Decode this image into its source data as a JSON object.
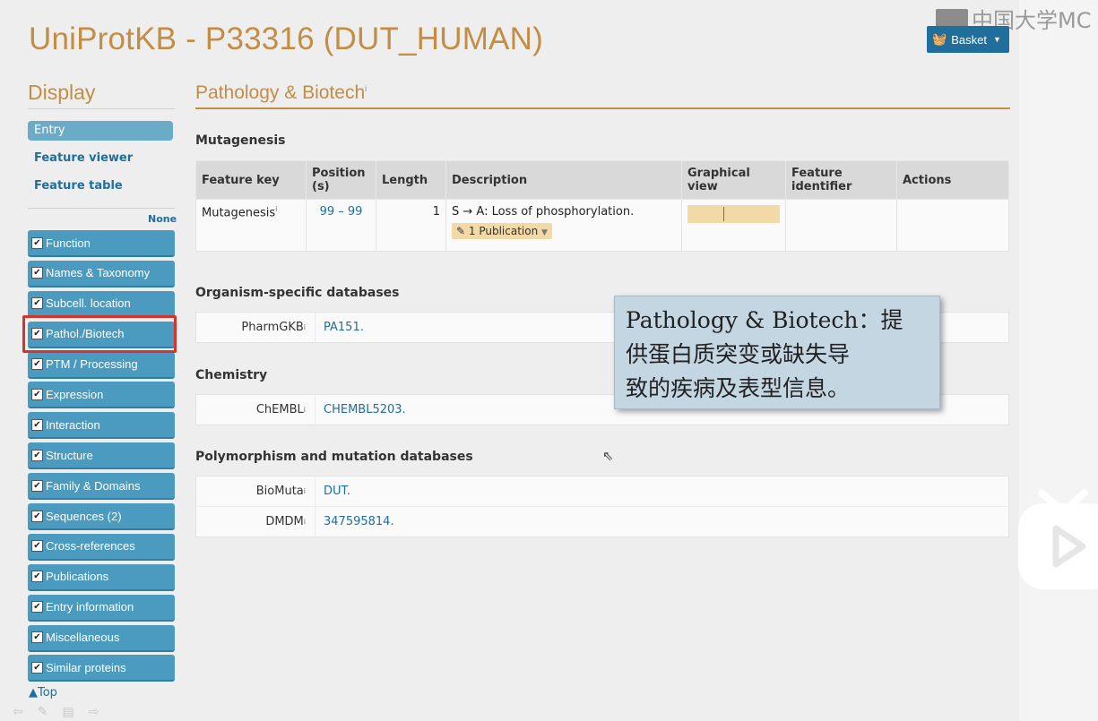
{
  "app": {
    "title": "UniProtKB - P33316 (DUT_HUMAN)",
    "basket_label": "Basket",
    "watermark": "中国大学MC"
  },
  "sidebar": {
    "display_label": "Display",
    "entry_label": "Entry",
    "links": [
      "Feature viewer",
      "Feature table"
    ],
    "none_label": "None",
    "sections": [
      {
        "label": "Function",
        "checked": true
      },
      {
        "label": "Names & Taxonomy",
        "checked": true
      },
      {
        "label": "Subcell. location",
        "checked": true
      },
      {
        "label": "Pathol./Biotech",
        "checked": true,
        "highlighted": true
      },
      {
        "label": "PTM / Processing",
        "checked": true
      },
      {
        "label": "Expression",
        "checked": true
      },
      {
        "label": "Interaction",
        "checked": true
      },
      {
        "label": "Structure",
        "checked": true
      },
      {
        "label": "Family & Domains",
        "checked": true
      },
      {
        "label": "Sequences (2)",
        "checked": true
      },
      {
        "label": "Cross-references",
        "checked": true
      },
      {
        "label": "Publications",
        "checked": true
      },
      {
        "label": "Entry information",
        "checked": true
      },
      {
        "label": "Miscellaneous",
        "checked": true
      },
      {
        "label": "Similar proteins",
        "checked": true
      }
    ],
    "top_label": "Top",
    "highlight_color": "#d6332b"
  },
  "main": {
    "section_title": "Pathology & Biotech",
    "section_title_info": "i",
    "mutagenesis": {
      "heading": "Mutagenesis",
      "headers": [
        "Feature key",
        "Position (s)",
        "Length",
        "Description",
        "Graphical view",
        "Feature identifier",
        "Actions"
      ],
      "row": {
        "feature_key": "Mutagenesis",
        "position": "99 – 99",
        "length": "1",
        "description": "S → A: Loss of phosphorylation.",
        "publication_badge": "1 Publication"
      }
    },
    "organism_db": {
      "heading": "Organism-specific databases",
      "rows": [
        {
          "key": "PharmGKB",
          "value": "PA151."
        }
      ]
    },
    "chemistry": {
      "heading": "Chemistry",
      "rows": [
        {
          "key": "ChEMBL",
          "value": "CHEMBL5203."
        }
      ]
    },
    "polymorphism": {
      "heading": "Polymorphism and mutation databases",
      "rows": [
        {
          "key": "BioMuta",
          "value": "DUT."
        },
        {
          "key": "DMDM",
          "value": "347595814."
        }
      ]
    }
  },
  "annotation": {
    "line1": "Pathology & Biotech：提",
    "line2": "供蛋白质突变或缺失导",
    "line3": "致的疾病及表型信息。"
  },
  "colors": {
    "title": "#c38d43",
    "link": "#1f6e9c",
    "sidebar_button": "#4a9bbf",
    "annotation_bg": "#c5d6e3",
    "badge": "#f2d9a6"
  }
}
